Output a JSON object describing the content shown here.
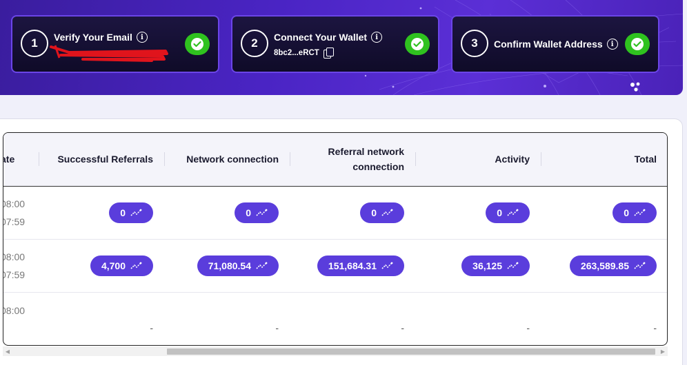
{
  "steps": [
    {
      "number": "1",
      "title": "Verify Your Email",
      "subtitle": "",
      "status": "complete"
    },
    {
      "number": "2",
      "title": "Connect Your Wallet",
      "subtitle": "8bc2...eRCT",
      "status": "complete"
    },
    {
      "number": "3",
      "title": "Confirm Wallet Address",
      "subtitle": "",
      "status": "complete"
    }
  ],
  "icons": {
    "info": "info-icon",
    "check": "check-circle-icon",
    "copy": "copy-icon",
    "trend": "trend-icon"
  },
  "colors": {
    "banner": "#4a24c4",
    "card_border": "#6b45e8",
    "check_green": "#2fc21f",
    "pill": "#5a3ddc"
  },
  "table": {
    "columns": [
      "ate",
      "Successful Referrals",
      "Network connection",
      "Referral network connection",
      "Activity",
      "Total"
    ],
    "rows": [
      {
        "date_lines": [
          "08:00",
          "07:59"
        ],
        "referrals": "0",
        "network": "0",
        "referral_network": "0",
        "activity": "0",
        "total": "0"
      },
      {
        "date_lines": [
          "08:00",
          "07:59"
        ],
        "referrals": "4,700",
        "network": "71,080.54",
        "referral_network": "151,684.31",
        "activity": "36,125",
        "total": "263,589.85"
      },
      {
        "date_lines": [
          "08:00",
          ""
        ],
        "referrals": "-",
        "network": "-",
        "referral_network": "-",
        "activity": "-",
        "total": "-"
      }
    ]
  }
}
